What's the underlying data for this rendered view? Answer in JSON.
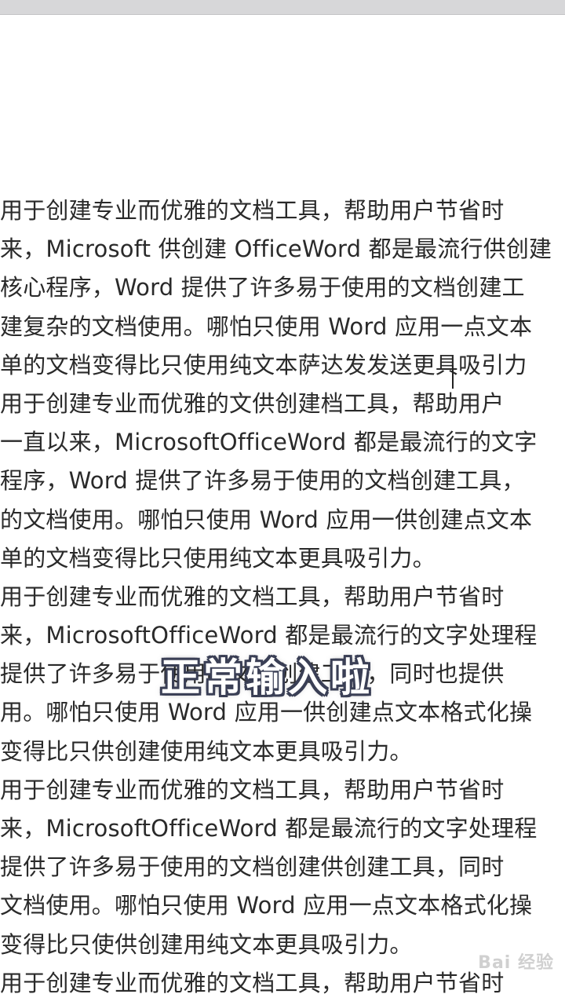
{
  "document": {
    "lines": [
      "用于创建专业而优雅的文档工具，帮助用户节省时",
      "来，Microsoft 供创建 OfficeWord 都是最流行供创建",
      "核心程序，Word 提供了许多易于使用的文档创建工",
      "建复杂的文档使用。哪怕只使用 Word 应用一点文本",
      "单的文档变得比只使用纯文本萨达发发送更具吸引力",
      "用于创建专业而优雅的文供创建档工具，帮助用户",
      "一直以来，MicrosoftOfficeWord 都是最流行的文字",
      "程序，Word 提供了许多易于使用的文档创建工具，",
      "的文档使用。哪怕只使用 Word 应用一供创建点文本",
      "单的文档变得比只使用纯文本更具吸引力。",
      "用于创建专业而优雅的文档工具，帮助用户节省时",
      "来，MicrosoftOfficeWord 都是最流行的文字处理程",
      "提供了许多易于使用的文档创建工具，同时也提供",
      "用。哪怕只使用 Word 应用一供创建点文本格式化操",
      "变得比只供创建使用纯文本更具吸引力。",
      "用于创建专业而优雅的文档工具，帮助用户节省时",
      "来，MicrosoftOfficeWord 都是最流行的文字处理程",
      "提供了许多易于使用的文档创建供创建工具，同时",
      "文档使用。哪怕只使用 Word 应用一点文本格式化操",
      "变得比只使供创建用纯文本更具吸引力。",
      "用于创建专业而优雅的文档工具，帮助用户节省时"
    ]
  },
  "overlay": {
    "subtitle": "正常输入啦"
  },
  "watermark": {
    "text": "Bai 经验"
  },
  "colors": {
    "top_bar": "#d7d7d9",
    "page_background": "#ffffff",
    "text": "#2a2a2a",
    "subtitle_fill": "#ffffff",
    "subtitle_outline": "#3a3f55"
  }
}
